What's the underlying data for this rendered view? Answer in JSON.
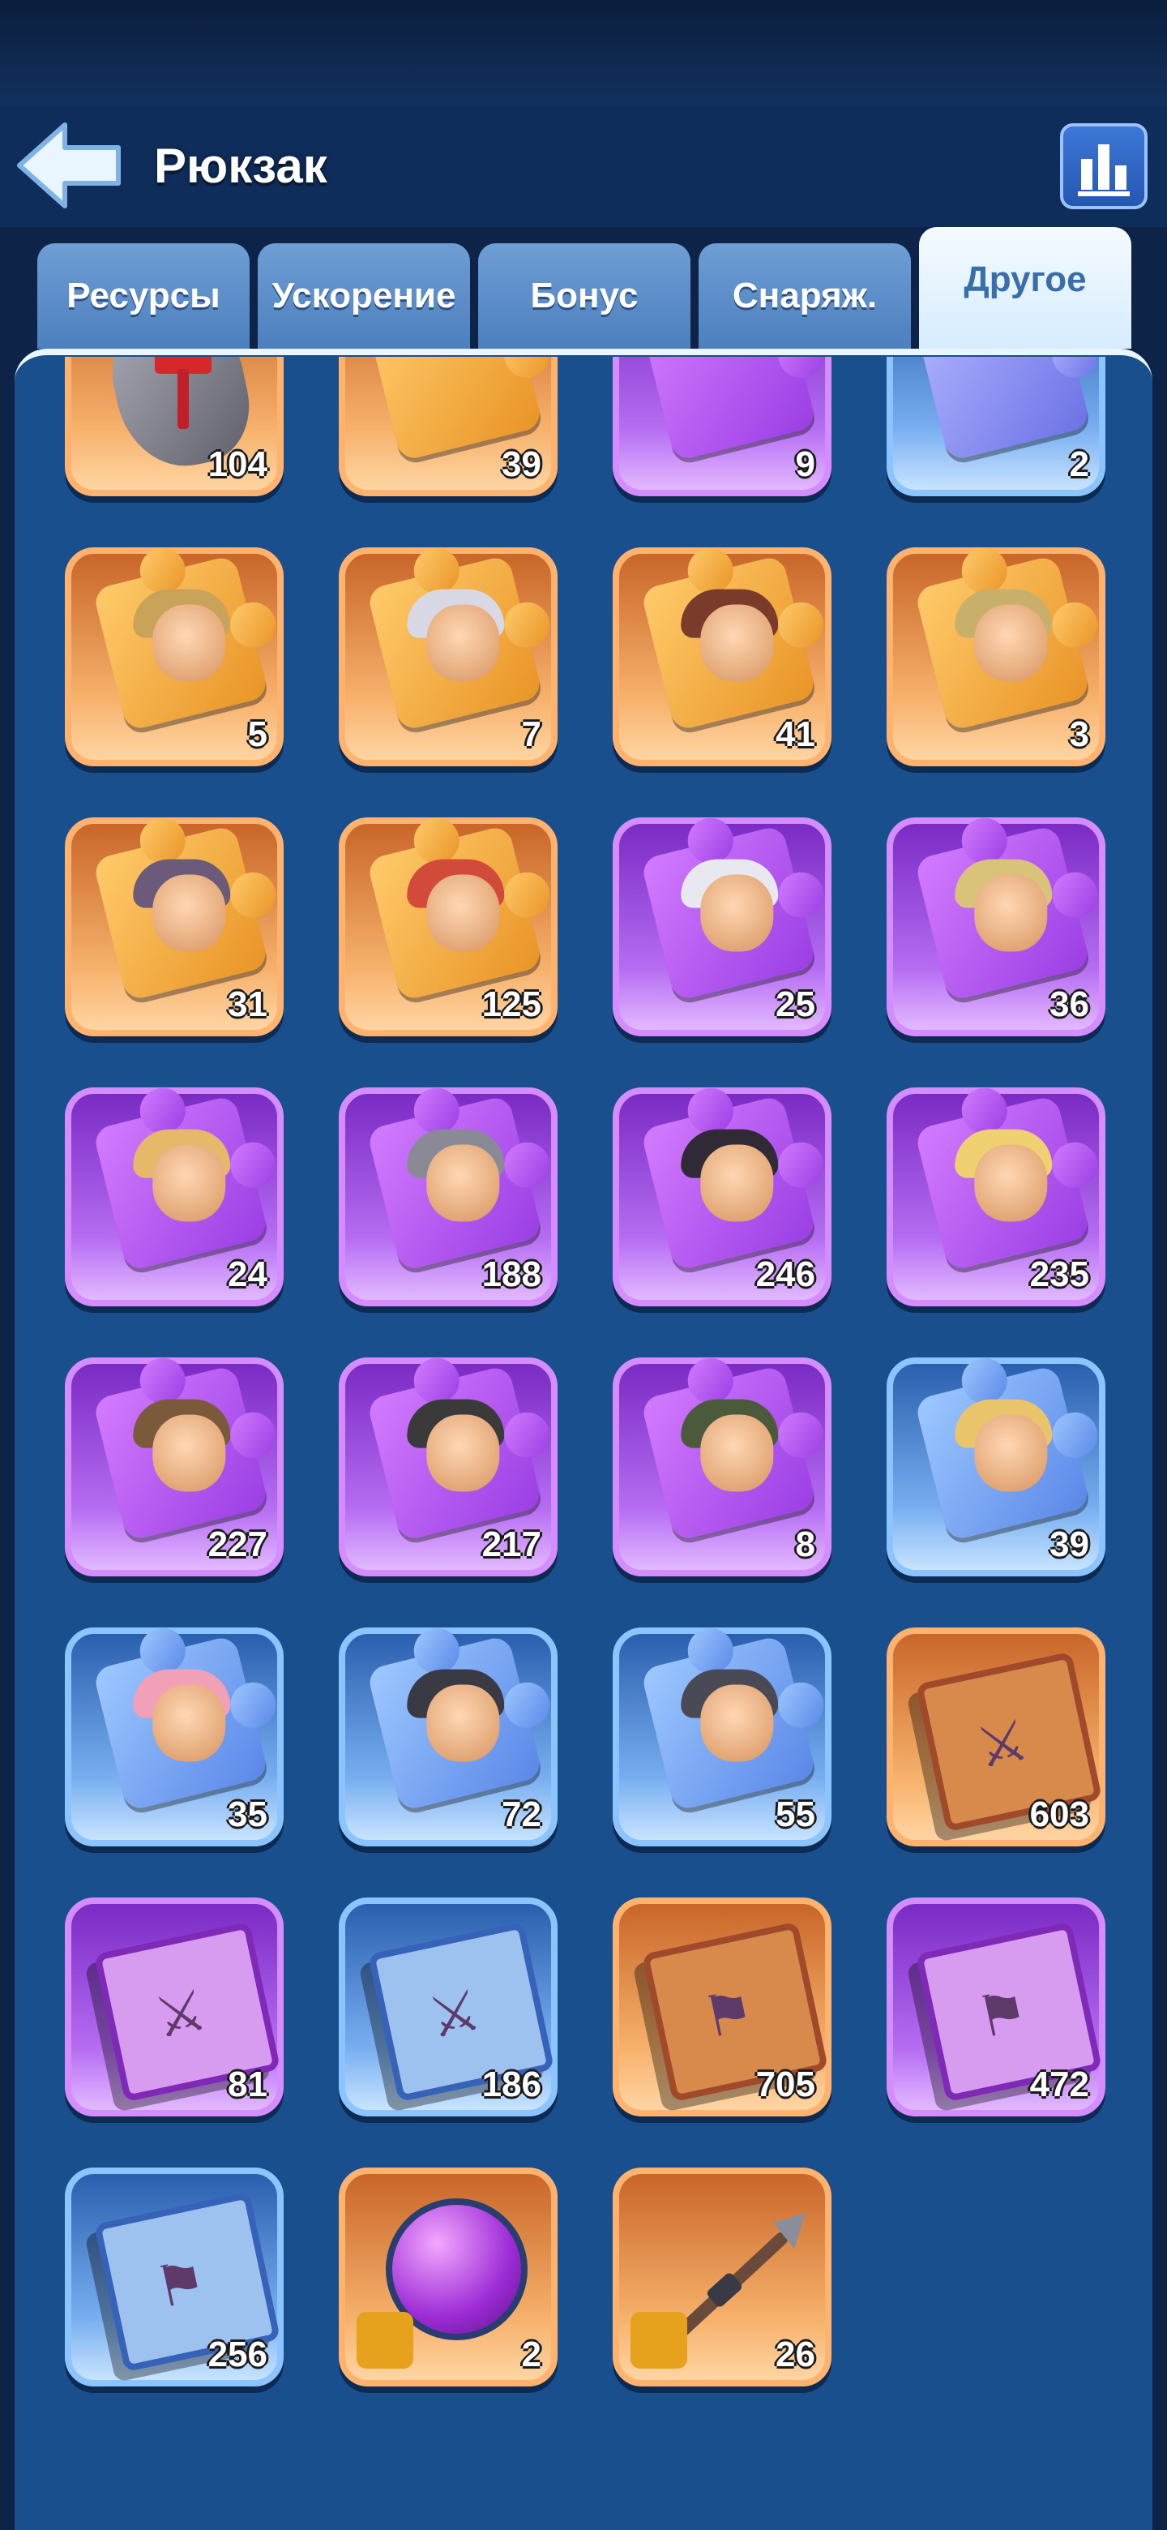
{
  "header": {
    "title": "Рюкзак"
  },
  "tabs": [
    {
      "label": "Ресурсы",
      "active": false
    },
    {
      "label": "Ускорение",
      "active": false
    },
    {
      "label": "Бонус",
      "active": false
    },
    {
      "label": "Снаряж.",
      "active": false
    },
    {
      "label": "Другое",
      "active": true
    }
  ],
  "colors": {
    "background": "#0d2448",
    "panel": "#1a4f8e",
    "rarity_orange": "#f6b16b",
    "rarity_purple": "#b56cf2",
    "rarity_blue": "#78aef0"
  },
  "items": [
    {
      "icon": "hammer-stone-icon",
      "rarity": "orange",
      "count": "104"
    },
    {
      "icon": "orange-puzzle-piece-icon",
      "rarity": "orange",
      "count": "39"
    },
    {
      "icon": "purple-puzzle-piece-icon",
      "rarity": "purple",
      "count": "9"
    },
    {
      "icon": "blue-puzzle-piece-icon",
      "rarity": "blue",
      "count": "2"
    },
    {
      "icon": "hero-fragment-icon",
      "rarity": "orange",
      "count": "5"
    },
    {
      "icon": "hero-fragment-icon",
      "rarity": "orange",
      "count": "7"
    },
    {
      "icon": "hero-fragment-icon",
      "rarity": "orange",
      "count": "41"
    },
    {
      "icon": "hero-fragment-icon",
      "rarity": "orange",
      "count": "3"
    },
    {
      "icon": "hero-fragment-icon",
      "rarity": "orange",
      "count": "31"
    },
    {
      "icon": "hero-fragment-icon",
      "rarity": "orange",
      "count": "125"
    },
    {
      "icon": "hero-fragment-icon",
      "rarity": "purple",
      "count": "25"
    },
    {
      "icon": "hero-fragment-icon",
      "rarity": "purple",
      "count": "36"
    },
    {
      "icon": "hero-fragment-icon",
      "rarity": "purple",
      "count": "24"
    },
    {
      "icon": "hero-fragment-icon",
      "rarity": "purple",
      "count": "188"
    },
    {
      "icon": "hero-fragment-icon",
      "rarity": "purple",
      "count": "246"
    },
    {
      "icon": "hero-fragment-icon",
      "rarity": "purple",
      "count": "235"
    },
    {
      "icon": "hero-fragment-icon",
      "rarity": "purple",
      "count": "227"
    },
    {
      "icon": "hero-fragment-icon",
      "rarity": "purple",
      "count": "217"
    },
    {
      "icon": "hero-fragment-icon",
      "rarity": "purple",
      "count": "8"
    },
    {
      "icon": "hero-fragment-icon",
      "rarity": "blue",
      "count": "39"
    },
    {
      "icon": "hero-fragment-icon",
      "rarity": "blue",
      "count": "35"
    },
    {
      "icon": "hero-fragment-icon",
      "rarity": "blue",
      "count": "72"
    },
    {
      "icon": "hero-fragment-icon",
      "rarity": "blue",
      "count": "55"
    },
    {
      "icon": "skill-book-swords-icon",
      "rarity": "orange",
      "count": "603"
    },
    {
      "icon": "skill-book-swords-icon",
      "rarity": "purple",
      "count": "81"
    },
    {
      "icon": "skill-book-swords-icon",
      "rarity": "blue",
      "count": "186"
    },
    {
      "icon": "skill-book-flag-icon",
      "rarity": "orange",
      "count": "705"
    },
    {
      "icon": "skill-book-flag-icon",
      "rarity": "purple",
      "count": "472"
    },
    {
      "icon": "skill-book-flag-icon",
      "rarity": "blue",
      "count": "256"
    },
    {
      "icon": "gear-orb-fragment-icon",
      "rarity": "orange",
      "count": "2"
    },
    {
      "icon": "spear-fragment-icon",
      "rarity": "orange",
      "count": "26"
    }
  ]
}
